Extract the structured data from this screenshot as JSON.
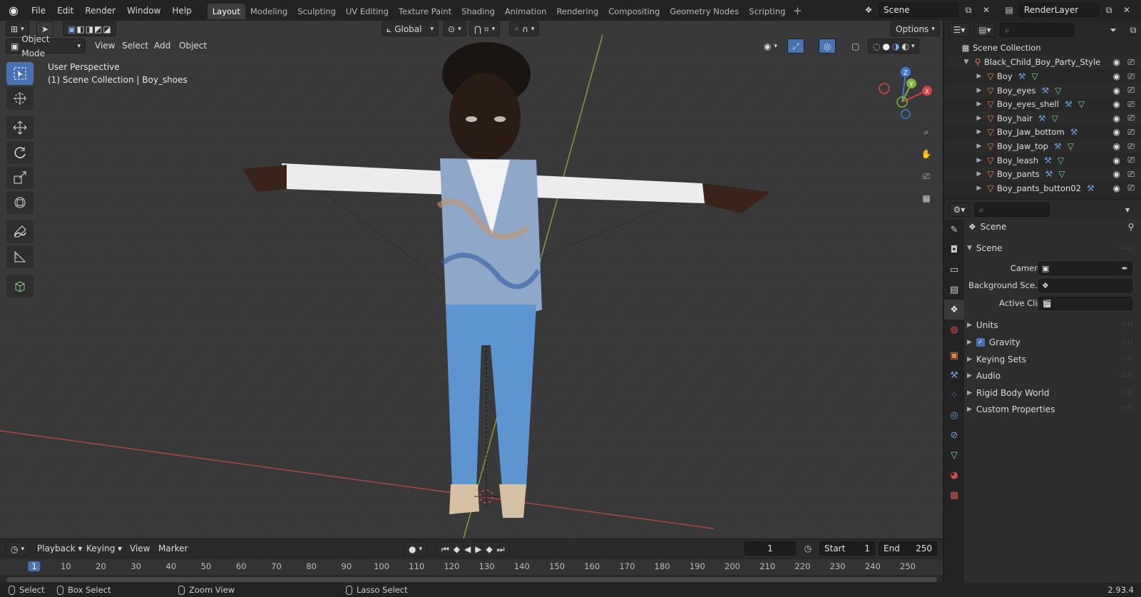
{
  "topbar": {
    "menus": [
      "File",
      "Edit",
      "Render",
      "Window",
      "Help"
    ],
    "workspace_tabs": [
      "Layout",
      "Modeling",
      "Sculpting",
      "UV Editing",
      "Texture Paint",
      "Shading",
      "Animation",
      "Rendering",
      "Compositing",
      "Geometry Nodes",
      "Scripting"
    ],
    "active_tab": "Layout",
    "add_tab": "+",
    "scene_name": "Scene",
    "view_layer": "RenderLayer"
  },
  "viewport": {
    "orientation": "Global",
    "options_label": "Options",
    "mode": "Object Mode",
    "menus": [
      "View",
      "Select",
      "Add",
      "Object"
    ],
    "perspective_label": "User Perspective",
    "collection_label": "(1) Scene Collection | Boy_shoes",
    "gizmo_axes": {
      "z": "Z",
      "y": "Y",
      "x": "X"
    },
    "colors": {
      "background": "#393939",
      "grid": "#454545",
      "x_axis": "#c14b4b",
      "y_axis": "#7fb338"
    }
  },
  "timeline": {
    "menus": [
      "Playback",
      "Keying",
      "View",
      "Marker"
    ],
    "current_frame": "1",
    "start_label": "Start",
    "start_value": "1",
    "end_label": "End",
    "end_value": "250",
    "ruler_ticks": [
      "1",
      "10",
      "20",
      "30",
      "40",
      "50",
      "60",
      "70",
      "80",
      "90",
      "100",
      "110",
      "120",
      "130",
      "140",
      "150",
      "160",
      "170",
      "180",
      "190",
      "200",
      "210",
      "220",
      "230",
      "240",
      "250"
    ]
  },
  "statusbar": {
    "select": "Select",
    "box_select": "Box Select",
    "zoom_view": "Zoom View",
    "lasso_select": "Lasso Select",
    "version": "2.93.4"
  },
  "outliner": {
    "root": "Scene Collection",
    "armature": "Black_Child_Boy_Party_Style",
    "items": [
      "Boy",
      "Boy_eyes",
      "Boy_eyes_shell",
      "Boy_hair",
      "Boy_Jaw_bottom",
      "Boy_Jaw_top",
      "Boy_leash",
      "Boy_pants",
      "Boy_pants_button02"
    ]
  },
  "properties": {
    "context": "Scene",
    "panel_title": "Scene",
    "fields": [
      {
        "label": "Camera"
      },
      {
        "label": "Background Sce..."
      },
      {
        "label": "Active Clip"
      }
    ],
    "subpanels": [
      "Units",
      "Gravity",
      "Keying Sets",
      "Audio",
      "Rigid Body World",
      "Custom Properties"
    ],
    "colors": {
      "accent": "#4772b3",
      "orange": "#e6853a",
      "green": "#6ddf9c"
    }
  }
}
